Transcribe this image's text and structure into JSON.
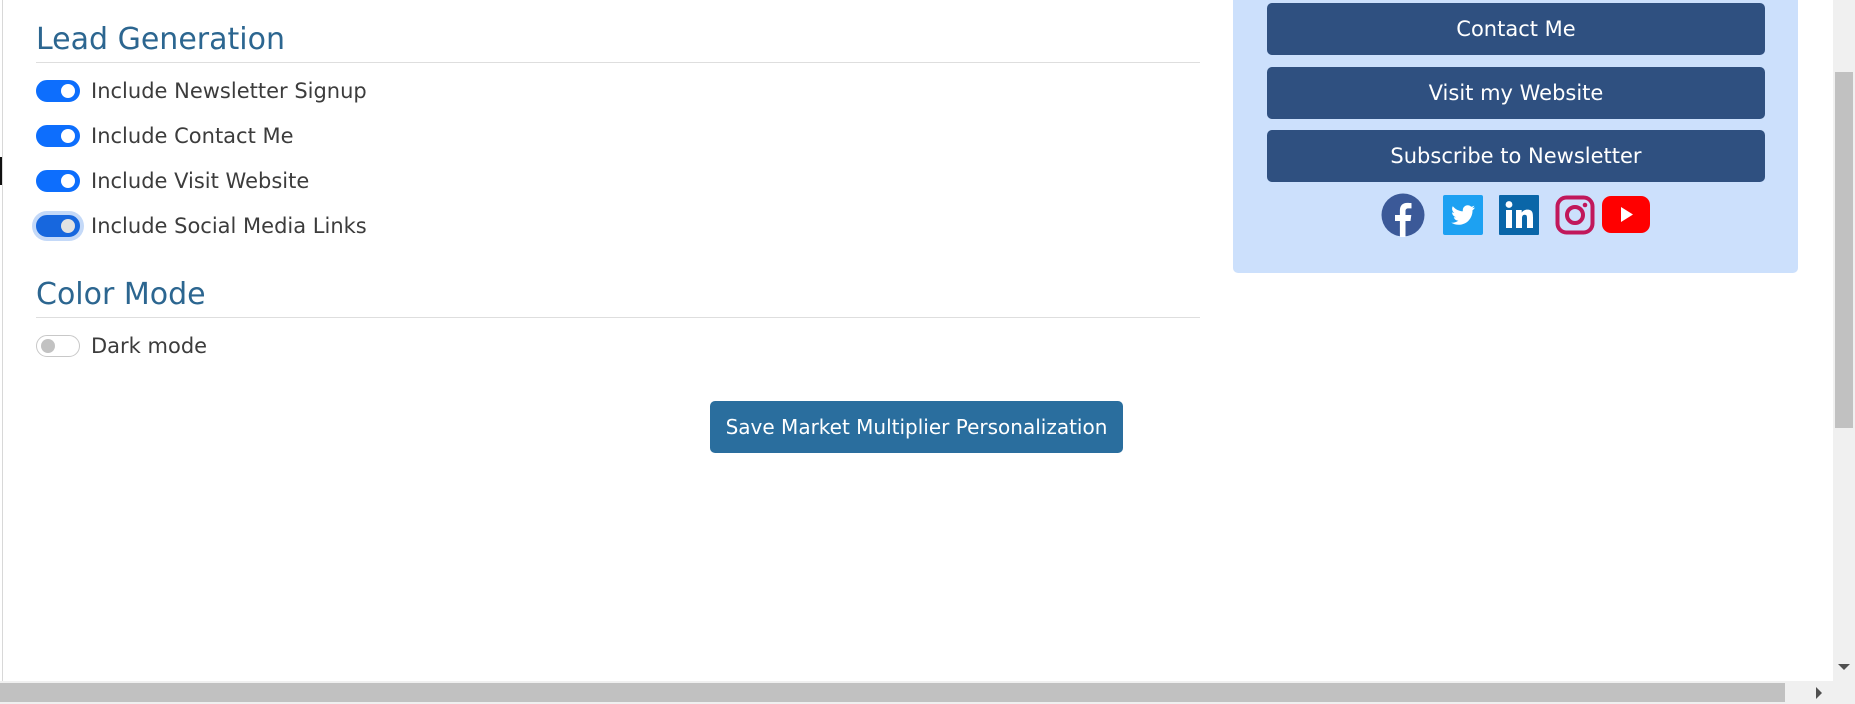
{
  "lead_generation": {
    "heading": "Lead Generation",
    "toggles": [
      {
        "label": "Include Newsletter Signup",
        "checked": true
      },
      {
        "label": "Include Contact Me",
        "checked": true
      },
      {
        "label": "Include Visit Website",
        "checked": true
      },
      {
        "label": "Include Social Media Links",
        "checked": true,
        "focused": true
      }
    ]
  },
  "color_mode": {
    "heading": "Color Mode",
    "toggles": [
      {
        "label": "Dark mode",
        "checked": false
      }
    ]
  },
  "save_button": {
    "label": "Save Market Multiplier Personalization"
  },
  "preview": {
    "buttons": [
      {
        "label": "Contact Me"
      },
      {
        "label": "Visit my Website"
      },
      {
        "label": "Subscribe to Newsletter"
      }
    ],
    "social_links": [
      {
        "name": "facebook-icon",
        "color": "#3b5998"
      },
      {
        "name": "twitter-icon",
        "color": "#1da1f2"
      },
      {
        "name": "linkedin-icon",
        "color": "#0a66a8"
      },
      {
        "name": "instagram-icon",
        "color": "#c1185b"
      },
      {
        "name": "youtube-icon",
        "color": "#ff0000"
      }
    ]
  },
  "colors": {
    "heading": "#2c6690",
    "toggle_on": "#0d6efd",
    "save_button": "#2a6e9e",
    "cta_button": "#2f5080",
    "preview_panel": "#cce0fc"
  }
}
